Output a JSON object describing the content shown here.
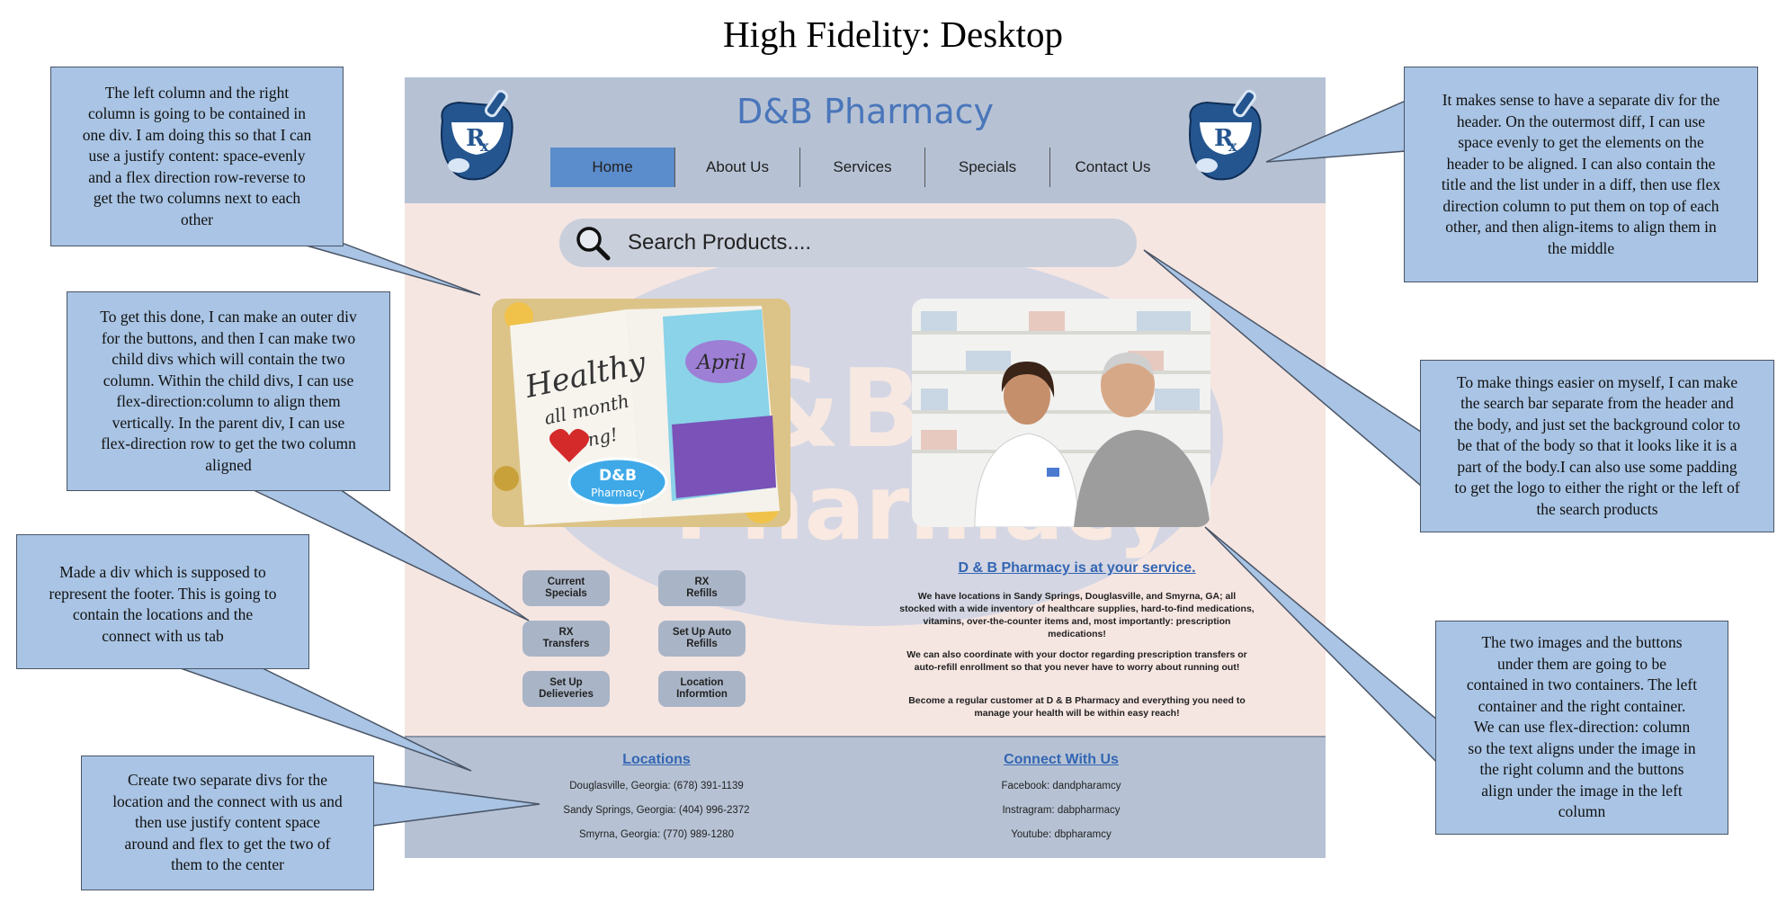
{
  "title": "High Fidelity: Desktop",
  "header": {
    "brand": "D&B Pharmacy",
    "logo_icon": "mortar-pestle-rx-icon",
    "nav": [
      "Home",
      "About Us",
      "Services",
      "Specials",
      "Contact Us"
    ]
  },
  "search": {
    "icon": "magnifier-icon",
    "placeholder": "Search Products...."
  },
  "watermark": {
    "line1": "D&B",
    "line2": "Pharmacy"
  },
  "left_image": {
    "text_healthy": "Healthy",
    "text_allmonth": "all month",
    "text_long": "long!",
    "text_april": "April",
    "badge_line1": "D&B",
    "badge_line2": "Pharmacy"
  },
  "buttons": [
    {
      "line1": "Current",
      "line2": "Specials"
    },
    {
      "line1": "RX",
      "line2": "Refills"
    },
    {
      "line1": "RX",
      "line2": "Transfers"
    },
    {
      "line1": "Set Up Auto",
      "line2": "Refills"
    },
    {
      "line1": "Set Up",
      "line2": "Delieveries"
    },
    {
      "line1": "Location",
      "line2": "Informtion"
    }
  ],
  "service": {
    "heading": "D & B Pharmacy is at your service.",
    "paragraphs": [
      "We have locations in Sandy Springs, Douglasville, and Smyrna, GA; all stocked with a wide inventory of healthcare supplies, hard-to-find medications, vitamins, over-the-counter items and, most importantly: prescription medications!",
      "We can also coordinate with your doctor regarding prescription transfers or auto-refill enrollment so that you never have to worry about running out!",
      "Become a regular customer at D & B Pharmacy and everything you need to manage your health will be within easy reach!"
    ]
  },
  "footer": {
    "locations_title": "Locations",
    "locations": [
      "Douglasville, Georgia: (678) 391-1139",
      "Sandy Springs, Georgia:  (404) 996-2372",
      "Smyrna, Georgia: (770) 989-1280"
    ],
    "connect_title": "Connect With Us",
    "connect": [
      "Facebook: dandpharamcy",
      "Instragram: dabpharmacy",
      "Youtube: dbpharamcy"
    ]
  },
  "callouts": {
    "left1": [
      "The left column and the right",
      "column is going to be contained in",
      "one div. I am doing this so that I can",
      "use a justify content: space-evenly",
      "and a flex direction row-reverse to",
      "get the two columns next to each",
      "other"
    ],
    "left2": [
      "To get this done, I can make an outer div",
      "for the buttons, and then I can make two",
      "child divs which will contain the two",
      "column. Within the child divs, I can use",
      "flex-direction:column to align them",
      "vertically.  In the parent div, I can use",
      "flex-direction row to get the two column",
      "aligned"
    ],
    "left3": [
      "Made a div which is supposed to",
      "represent the footer. This is going to",
      "contain the locations and the",
      "connect with us tab"
    ],
    "left4": [
      "Create two separate divs for the",
      "location and the connect with us and",
      "then use justify content space",
      "around and flex to get the two of",
      "them to the center"
    ],
    "right1": [
      "It makes sense to have a separate div for the",
      "header.  On the outermost diff, I can use",
      "space evenly to get the elements on the",
      "header to be aligned. I can also contain the",
      "title and the list under in a diff, then use flex",
      "direction column to put them on top of each",
      "other, and then align-items to align them in",
      "the middle"
    ],
    "right2": [
      "To make things easier on myself, I can make",
      "the search bar separate from the header and",
      "the body, and just set the background color to",
      "be that of the body so that it looks like it is a",
      "part of the body.I can also use some padding",
      "to get the logo to either the right or the left of",
      "the search products"
    ],
    "right3": [
      "The two images and the buttons",
      "under them are going to be",
      "contained in two containers. The left",
      "container and the right container.",
      "We can use flex-direction: column",
      "so the text aligns under the image in",
      "the right column and the buttons",
      "align under the image in the left",
      "column"
    ]
  }
}
